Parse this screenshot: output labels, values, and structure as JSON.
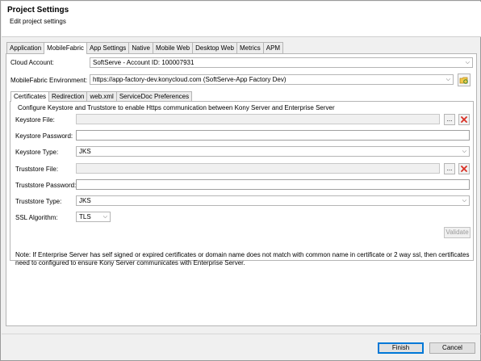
{
  "dialog": {
    "title": "Project Settings",
    "subtitle": "Edit project settings"
  },
  "main_tabs": [
    "Application",
    "MobileFabric",
    "App Settings",
    "Native",
    "Mobile Web",
    "Desktop Web",
    "Metrics",
    "APM"
  ],
  "main_tab_active": "MobileFabric",
  "cloud_account": {
    "label": "Cloud Account:",
    "value": "SoftServe - Account ID: 100007931"
  },
  "environment": {
    "label": "MobileFabric Environment:",
    "value": "https://app-factory-dev.konycloud.com (SoftServe-App Factory Dev)"
  },
  "sub_tabs": [
    "Certificates",
    "Redirection",
    "web.xml",
    "ServiceDoc Preferences"
  ],
  "sub_tab_active": "Certificates",
  "certificates": {
    "intro": "Configure Keystore and Truststore to enable Https communication between Kony Server and Enterprise Server",
    "keystore_file_label": "Keystore File:",
    "keystore_password_label": "Keystore Password:",
    "keystore_type_label": "Keystore Type:",
    "keystore_type_value": "JKS",
    "truststore_file_label": "Truststore File:",
    "truststore_password_label": "Truststore Password:",
    "truststore_type_label": "Truststore Type:",
    "truststore_type_value": "JKS",
    "ssl_label": "SSL Algorithm:",
    "ssl_value": "TLS",
    "browse_label": "...",
    "validate_label": "Validate",
    "note": "Note: If Enterprise Server has self signed or expired certificates or domain name does not match with common name in certificate or 2 way ssl, then certificates need to configured to ensure Kony Server communicates with Enterprise Server."
  },
  "footer": {
    "finish_label": "Finish",
    "cancel_label": "Cancel"
  },
  "icons": {
    "delete": "delete-x-icon",
    "refresh": "refresh-folder-icon",
    "dropdown": "chevron-down-icon"
  },
  "colors": {
    "delete_red": "#d93025",
    "primary_border": "#0078d7"
  }
}
